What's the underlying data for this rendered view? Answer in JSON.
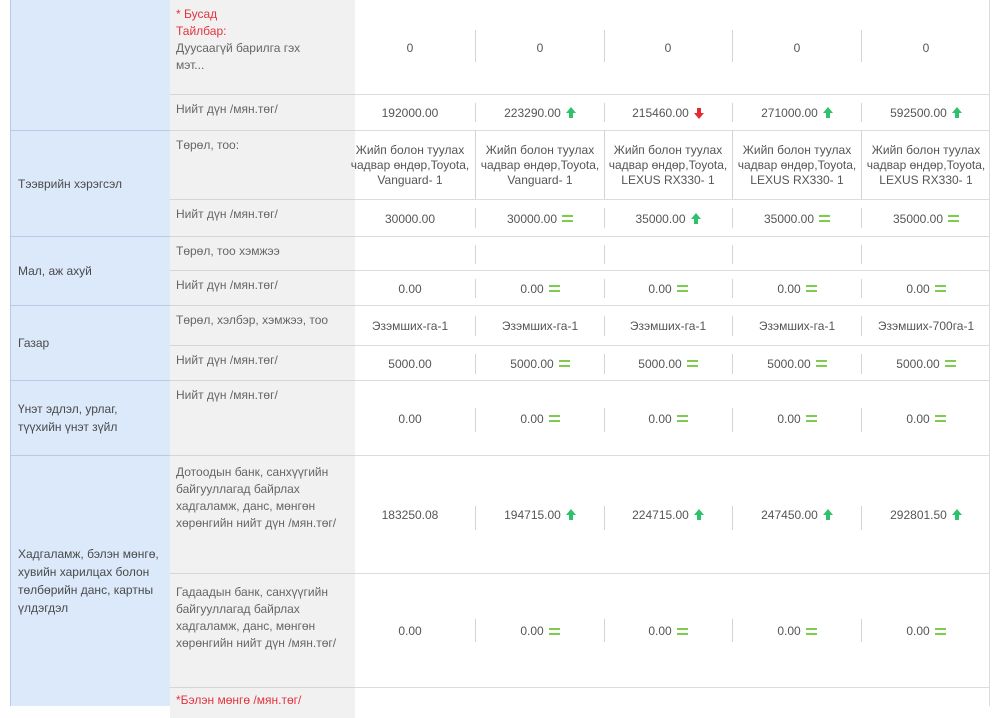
{
  "rows": {
    "other": {
      "label_star": "* Бусад",
      "label_note": "Тайлбар:",
      "label_text": "Дуусаагүй барилга гэх мэт...",
      "values": [
        "0",
        "0",
        "0",
        "0",
        "0"
      ]
    },
    "other_total": {
      "label": "Нийт дүн /мян.төг/",
      "values": [
        "192000.00",
        "223290.00",
        "215460.00",
        "271000.00",
        "592500.00"
      ],
      "trends": [
        "none",
        "up",
        "down",
        "up",
        "up"
      ]
    },
    "vehicles": {
      "category": "Тээврийн хэрэгсэл",
      "type_label": "Төрөл, тоо:",
      "types": [
        "Жийп болон туулах чадвар өндөр,Toyota, Vanguard- 1",
        "Жийп болон туулах чадвар өндөр,Toyota, Vanguard- 1",
        "Жийп болон туулах чадвар өндөр,Toyota, LEXUS RX330- 1",
        "Жийп болон туулах чадвар өндөр,Toyota, LEXUS RX330- 1",
        "Жийп болон туулах чадвар өндөр,Toyota, LEXUS RX330- 1"
      ],
      "total_label": "Нийт дүн /мян.төг/",
      "totals": [
        "30000.00",
        "30000.00",
        "35000.00",
        "35000.00",
        "35000.00"
      ],
      "trends": [
        "none",
        "same",
        "up",
        "same",
        "same"
      ]
    },
    "livestock": {
      "category": "Мал, аж ахуй",
      "type_label": "Төрөл, тоо хэмжээ",
      "types": [
        "",
        "",
        "",
        "",
        ""
      ],
      "total_label": "Нийт дүн /мян.төг/",
      "totals": [
        "0.00",
        "0.00",
        "0.00",
        "0.00",
        "0.00"
      ],
      "trends": [
        "none",
        "same",
        "same",
        "same",
        "same"
      ]
    },
    "land": {
      "category": "Газар",
      "type_label": "Төрөл, хэлбэр, хэмжээ, тоо",
      "types": [
        "Эзэмших-га-1",
        "Эзэмших-га-1",
        "Эзэмших-га-1",
        "Эзэмших-га-1",
        "Эзэмших-700га-1"
      ],
      "total_label": "Нийт дүн /мян.төг/",
      "totals": [
        "5000.00",
        "5000.00",
        "5000.00",
        "5000.00",
        "5000.00"
      ],
      "trends": [
        "none",
        "same",
        "same",
        "same",
        "same"
      ]
    },
    "valuables": {
      "category": "Үнэт эдлэл, урлаг, түүхийн үнэт зүйл",
      "total_label": "Нийт дүн /мян.төг/",
      "totals": [
        "0.00",
        "0.00",
        "0.00",
        "0.00",
        "0.00"
      ],
      "trends": [
        "none",
        "same",
        "same",
        "same",
        "same"
      ]
    },
    "savings": {
      "category": "Хадгаламж, бэлэн мөнгө, хувийн харилцах болон төлбөрийн данс, картны үлдэгдэл",
      "domestic_label": "Дотоодын банк, санхүүгийн байгууллагад байрлах хадгаламж, данс, мөнгөн хөрөнгийн нийт дүн /мян.төг/",
      "domestic": [
        "183250.08",
        "194715.00",
        "224715.00",
        "247450.00",
        "292801.50"
      ],
      "domestic_trends": [
        "none",
        "up",
        "up",
        "up",
        "up"
      ],
      "foreign_label": "Гадаадын банк, санхүүгийн байгууллагад байрлах хадгаламж, данс, мөнгөн хөрөнгийн нийт дүн /мян.төг/",
      "foreign": [
        "0.00",
        "0.00",
        "0.00",
        "0.00",
        "0.00"
      ],
      "foreign_trends": [
        "none",
        "same",
        "same",
        "same",
        "same"
      ],
      "cash_label": "*Бэлэн мөнгө /мян.төг/"
    }
  },
  "colors": {
    "category_bg": "#dbe9fb",
    "label_bg": "#f1f1f1",
    "up": "#2fc16b",
    "down": "#e22b35",
    "same": "#7dcc4f",
    "note_red": "#e2343f"
  }
}
